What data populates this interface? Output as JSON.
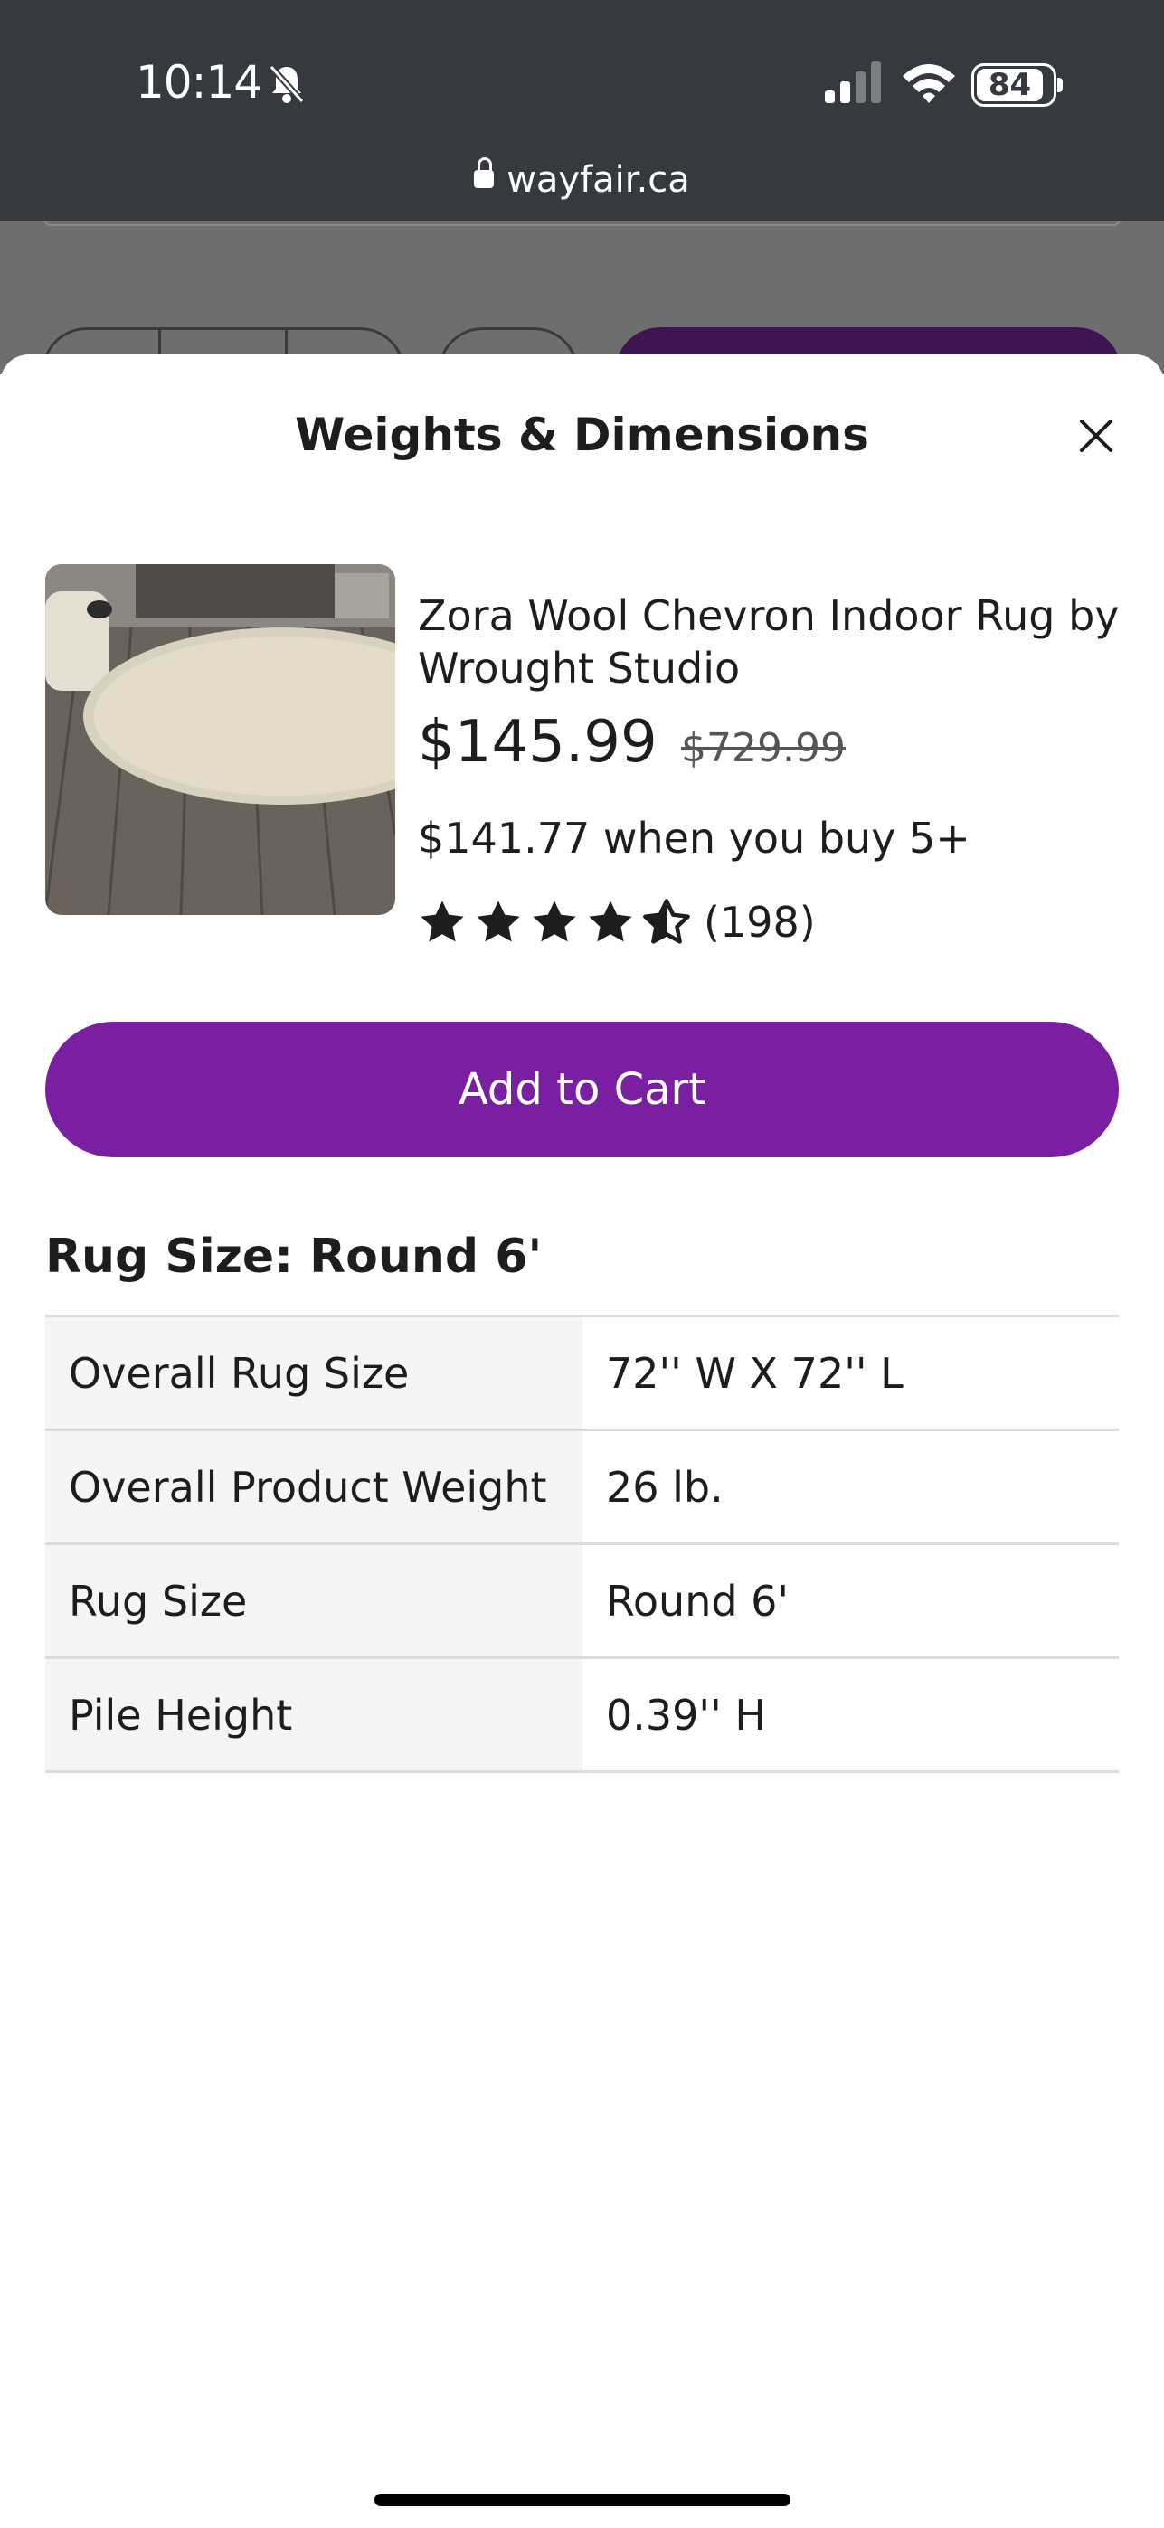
{
  "status_bar": {
    "time": "10:14",
    "battery": "84"
  },
  "browser": {
    "url": "wayfair.ca"
  },
  "sheet": {
    "title": "Weights & Dimensions",
    "product": {
      "name": "Zora Wool Chevron Indoor Rug by Wrought Studio",
      "price": "$145.99",
      "original_price": "$729.99",
      "bulk_price": "$141.77 when you buy 5+",
      "rating": 4.5,
      "review_count": "(198)"
    },
    "add_to_cart_label": "Add to Cart",
    "section_title": "Rug Size: Round 6'",
    "specs": [
      {
        "label": "Overall Rug Size",
        "value": "72'' W X 72'' L"
      },
      {
        "label": "Overall Product Weight",
        "value": "26 lb."
      },
      {
        "label": "Rug Size",
        "value": "Round 6'"
      },
      {
        "label": "Pile Height",
        "value": "0.39'' H"
      }
    ]
  },
  "colors": {
    "accent": "#7b1fa2",
    "topbar": "#36393d"
  }
}
